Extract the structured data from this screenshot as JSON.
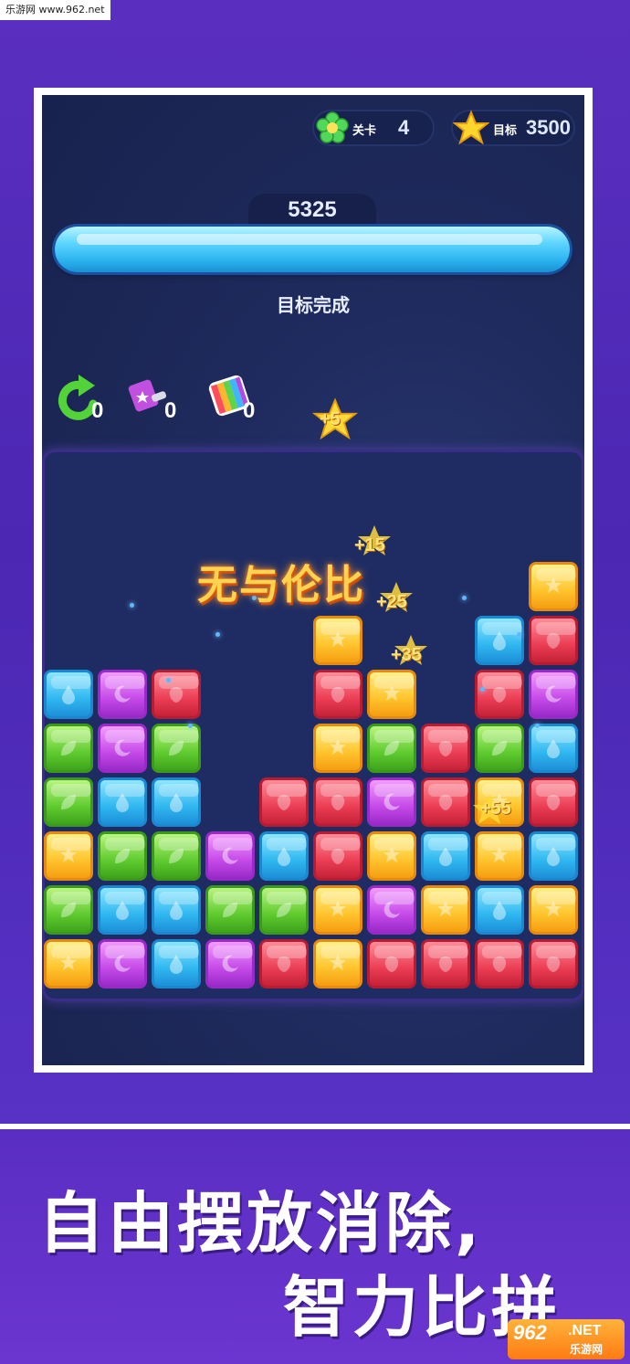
{
  "watermark": "乐游网 www.962.net",
  "hud": {
    "level_label": "关卡",
    "level_value": "4",
    "target_label": "目标",
    "target_value": "3500"
  },
  "score": "5325",
  "progress": 1.0,
  "goal_status": "目标完成",
  "tools": [
    {
      "name": "undo",
      "count": "0"
    },
    {
      "name": "hammer",
      "count": "0"
    },
    {
      "name": "rainbow",
      "count": "0"
    }
  ],
  "floating_points": [
    "+5",
    "+15",
    "+25",
    "+35",
    "+55"
  ],
  "combo_text": "无与伦比",
  "board": {
    "columns": 10,
    "rows_from_bottom": [
      [
        "yellow",
        "purple",
        "blue",
        "purple",
        "red",
        "yellow",
        "red",
        "red",
        "red",
        "red"
      ],
      [
        "green",
        "blue",
        "blue",
        "green",
        "green",
        "yellow",
        "purple",
        "yellow",
        "blue",
        "yellow"
      ],
      [
        "yellow",
        "green",
        "green",
        "purple",
        "blue",
        "red",
        "yellow",
        "blue",
        "yellow",
        "blue"
      ],
      [
        "green",
        "blue",
        "blue",
        null,
        "red",
        "red",
        "purple",
        "red",
        "yellow",
        "red"
      ],
      [
        "green",
        "purple",
        "green",
        null,
        null,
        "yellow",
        "green",
        "red",
        "green",
        "blue"
      ],
      [
        "blue",
        "purple",
        "red",
        null,
        null,
        "red",
        "yellow",
        null,
        "red",
        "purple"
      ],
      [
        null,
        null,
        null,
        null,
        null,
        "yellow",
        null,
        null,
        "blue",
        "red"
      ],
      [
        null,
        null,
        null,
        null,
        null,
        null,
        null,
        null,
        null,
        "yellow"
      ]
    ]
  },
  "slogan": {
    "line1": "自由摆放消除,",
    "line2": "智力比拼"
  },
  "logo": {
    "number": "962",
    "net": ".NET",
    "cn": "乐游网"
  }
}
